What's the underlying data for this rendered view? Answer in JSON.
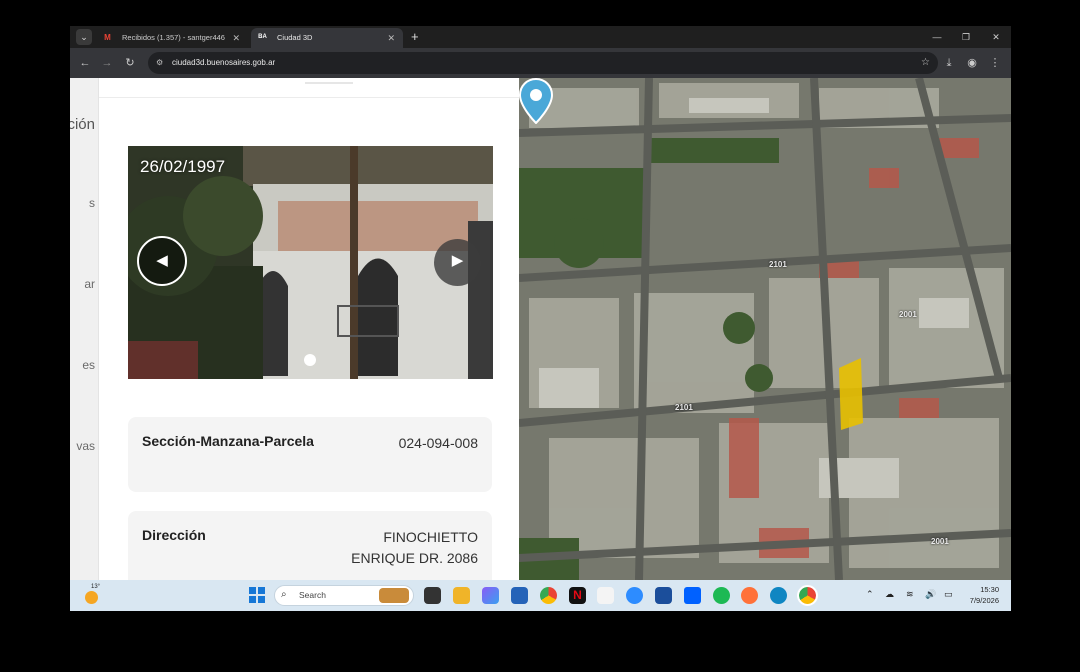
{
  "browser": {
    "tabs": [
      {
        "label": "Recibidos (1.357) - santger446",
        "favicon": "gmail-icon",
        "active": false
      },
      {
        "label": "Ciudad 3D",
        "favicon": "ciudad3d-icon",
        "active": true
      }
    ],
    "url": "ciudad3d.buenosaires.gob.ar"
  },
  "sidebar": {
    "fragments": [
      "ción",
      "s",
      "ar",
      "es",
      "vas"
    ]
  },
  "photo": {
    "date": "26/02/1997"
  },
  "info_cards": [
    {
      "label": "Sección-Manzana-Parcela",
      "value": "024-094-008"
    },
    {
      "label": "Dirección",
      "value_line1": "FINOCHIETTO",
      "value_line2": "ENRIQUE DR. 2086"
    }
  ],
  "map": {
    "street_labels": [
      "2101",
      "2001",
      "2101",
      "2001"
    ]
  },
  "taskbar": {
    "weather_temp": "13°",
    "search_placeholder": "Search",
    "time": "15:30",
    "date": "7/9/2026"
  },
  "colors": {
    "taskbar_bg": "#d9e7f2",
    "browser_chrome": "#35363a",
    "pin": "#4aa8d8",
    "parcel_highlight": "#e8c000"
  }
}
